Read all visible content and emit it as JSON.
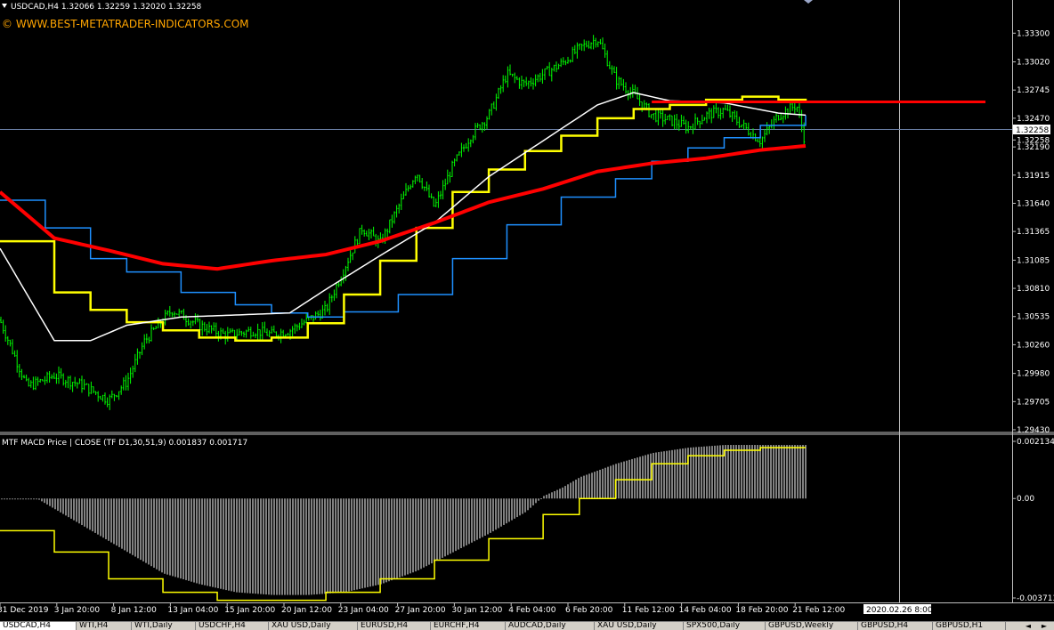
{
  "header": {
    "symbol_line": "USDCAD,H4  1.32066 1.32259 1.32020 1.32258",
    "watermark": "© WWW.BEST-METATRADER-INDICATORS.COM"
  },
  "price_axis": {
    "ticks": [
      "1.33300",
      "1.33020",
      "1.32745",
      "1.32470",
      "1.32258",
      "1.32190",
      "1.31915",
      "1.31640",
      "1.31365",
      "1.31085",
      "1.30810",
      "1.30535",
      "1.30260",
      "1.29980",
      "1.29705",
      "1.29430"
    ],
    "current_price": "1.32258"
  },
  "macd_panel": {
    "title": "MTF MACD Price | CLOSE  (TF D1,30,51,9) 0.001837 0.001717",
    "ticks": [
      "0.002134",
      "0.00",
      "-0.003713"
    ]
  },
  "time_axis": {
    "labels": [
      "31 Dec 2019",
      "3 Jan 20:00",
      "8 Jan 12:00",
      "13 Jan 04:00",
      "15 Jan 20:00",
      "20 Jan 12:00",
      "23 Jan 04:00",
      "27 Jan 20:00",
      "30 Jan 12:00",
      "4 Feb 04:00",
      "6 Feb 20:00",
      "11 Feb 12:00",
      "14 Feb 04:00",
      "18 Feb 20:00",
      "21 Feb 12:00"
    ],
    "crosshair_label": "2020.02.26 8:00"
  },
  "tabs": [
    "USDCAD,H4",
    "WTI,H4",
    "WTI,Daily",
    "USDCHF,H4",
    "XAU USD,Daily",
    "EURUSD,H4",
    "EURCHF,H4",
    "AUDCAD,Daily",
    "XAU USD,Daily",
    "SPX500,Daily",
    "GBPUSD,Weekly",
    "GBPUSD,H4",
    "GBPUSD,H1"
  ],
  "colors": {
    "candles": "#00ff00",
    "ma_slow": "#ff0000",
    "ma_white": "#ffffff",
    "step_yellow": "#ffff00",
    "step_blue": "#1e90ff",
    "macd_hist": "#808080",
    "macd_signal": "#ffff00"
  },
  "chart_data": {
    "type": "line",
    "main": {
      "ylim": [
        1.2943,
        1.3345
      ],
      "close_path": [
        [
          0,
          1.305
        ],
        [
          3,
          1.2985
        ],
        [
          6,
          1.2996
        ],
        [
          9,
          1.2987
        ],
        [
          12,
          1.2972
        ],
        [
          14,
          1.299
        ],
        [
          16,
          1.303
        ],
        [
          19,
          1.306
        ],
        [
          22,
          1.3045
        ],
        [
          25,
          1.3035
        ],
        [
          28,
          1.304
        ],
        [
          30,
          1.3036
        ],
        [
          32,
          1.304
        ],
        [
          34,
          1.305
        ],
        [
          36,
          1.306
        ],
        [
          38,
          1.31
        ],
        [
          40,
          1.314
        ],
        [
          42,
          1.3125
        ],
        [
          44,
          1.316
        ],
        [
          46,
          1.3195
        ],
        [
          48,
          1.316
        ],
        [
          50,
          1.32
        ],
        [
          52,
          1.323
        ],
        [
          54,
          1.325
        ],
        [
          56,
          1.329
        ],
        [
          58,
          1.328
        ],
        [
          60,
          1.329
        ],
        [
          62,
          1.33
        ],
        [
          64,
          1.3315
        ],
        [
          66,
          1.3325
        ],
        [
          68,
          1.3285
        ],
        [
          70,
          1.327
        ],
        [
          72,
          1.325
        ],
        [
          74,
          1.3245
        ],
        [
          76,
          1.3238
        ],
        [
          78,
          1.325
        ],
        [
          80,
          1.3255
        ],
        [
          82,
          1.324
        ],
        [
          84,
          1.3225
        ],
        [
          86,
          1.325
        ],
        [
          88,
          1.326
        ],
        [
          89,
          1.3222
        ]
      ],
      "ma_red": [
        [
          0,
          1.3175
        ],
        [
          6,
          1.313
        ],
        [
          12,
          1.3118
        ],
        [
          18,
          1.3105
        ],
        [
          24,
          1.31
        ],
        [
          30,
          1.3108
        ],
        [
          36,
          1.3114
        ],
        [
          42,
          1.3127
        ],
        [
          48,
          1.3145
        ],
        [
          54,
          1.3165
        ],
        [
          60,
          1.3178
        ],
        [
          66,
          1.3195
        ],
        [
          72,
          1.3203
        ],
        [
          78,
          1.3208
        ],
        [
          84,
          1.3216
        ],
        [
          89,
          1.322
        ]
      ],
      "ma_white": [
        [
          0,
          1.312
        ],
        [
          6,
          1.303
        ],
        [
          10,
          1.303
        ],
        [
          14,
          1.3045
        ],
        [
          20,
          1.3053
        ],
        [
          26,
          1.3055
        ],
        [
          32,
          1.3057
        ],
        [
          36,
          1.308
        ],
        [
          42,
          1.3113
        ],
        [
          48,
          1.3145
        ],
        [
          54,
          1.319
        ],
        [
          60,
          1.3225
        ],
        [
          66,
          1.326
        ],
        [
          70,
          1.3272
        ],
        [
          74,
          1.3264
        ],
        [
          80,
          1.3262
        ],
        [
          86,
          1.3252
        ],
        [
          89,
          1.325
        ]
      ],
      "step_yellow": [
        [
          0,
          1.3127
        ],
        [
          6,
          1.3077
        ],
        [
          10,
          1.306
        ],
        [
          14,
          1.3048
        ],
        [
          18,
          1.304
        ],
        [
          22,
          1.3033
        ],
        [
          26,
          1.303
        ],
        [
          30,
          1.3033
        ],
        [
          34,
          1.3047
        ],
        [
          38,
          1.3075
        ],
        [
          42,
          1.3108
        ],
        [
          46,
          1.314
        ],
        [
          50,
          1.3175
        ],
        [
          54,
          1.3197
        ],
        [
          58,
          1.3215
        ],
        [
          62,
          1.323
        ],
        [
          66,
          1.3247
        ],
        [
          70,
          1.3256
        ],
        [
          74,
          1.326
        ],
        [
          78,
          1.3265
        ],
        [
          82,
          1.3268
        ],
        [
          86,
          1.3265
        ],
        [
          89,
          1.3262
        ]
      ],
      "step_blue": [
        [
          0,
          1.3167
        ],
        [
          5,
          1.314
        ],
        [
          10,
          1.311
        ],
        [
          14,
          1.3097
        ],
        [
          20,
          1.3077
        ],
        [
          26,
          1.3065
        ],
        [
          30,
          1.3057
        ],
        [
          34,
          1.3053
        ],
        [
          38,
          1.3058
        ],
        [
          44,
          1.3075
        ],
        [
          50,
          1.311
        ],
        [
          56,
          1.3143
        ],
        [
          62,
          1.317
        ],
        [
          68,
          1.3188
        ],
        [
          72,
          1.3205
        ],
        [
          76,
          1.3218
        ],
        [
          80,
          1.3228
        ],
        [
          84,
          1.324
        ],
        [
          89,
          1.325
        ]
      ],
      "level_line": 1.3263
    },
    "macd": {
      "ylim": [
        -0.003713,
        0.002134
      ],
      "histogram": [
        [
          0,
          -0.0
        ],
        [
          4,
          -0.0
        ],
        [
          6,
          -0.0004
        ],
        [
          10,
          -0.0012
        ],
        [
          14,
          -0.002
        ],
        [
          18,
          -0.0028
        ],
        [
          22,
          -0.0032
        ],
        [
          26,
          -0.0035
        ],
        [
          30,
          -0.0036
        ],
        [
          34,
          -0.0036
        ],
        [
          38,
          -0.0035
        ],
        [
          42,
          -0.0032
        ],
        [
          46,
          -0.0027
        ],
        [
          50,
          -0.002
        ],
        [
          54,
          -0.0013
        ],
        [
          58,
          -0.0005
        ],
        [
          60,
          0.0001
        ],
        [
          62,
          0.0004
        ],
        [
          64,
          0.0008
        ],
        [
          68,
          0.0013
        ],
        [
          72,
          0.0017
        ],
        [
          76,
          0.0019
        ],
        [
          80,
          0.002
        ],
        [
          84,
          0.002
        ],
        [
          89,
          0.002
        ]
      ],
      "signal": [
        [
          0,
          -0.0012
        ],
        [
          6,
          -0.002
        ],
        [
          12,
          -0.003
        ],
        [
          18,
          -0.0035
        ],
        [
          24,
          -0.0038
        ],
        [
          30,
          -0.0038
        ],
        [
          36,
          -0.0035
        ],
        [
          42,
          -0.003
        ],
        [
          48,
          -0.0023
        ],
        [
          54,
          -0.0015
        ],
        [
          60,
          -0.0006
        ],
        [
          64,
          0.0
        ],
        [
          68,
          0.0007
        ],
        [
          72,
          0.0013
        ],
        [
          76,
          0.0016
        ],
        [
          80,
          0.0018
        ],
        [
          84,
          0.0019
        ],
        [
          89,
          0.0019
        ]
      ]
    }
  }
}
